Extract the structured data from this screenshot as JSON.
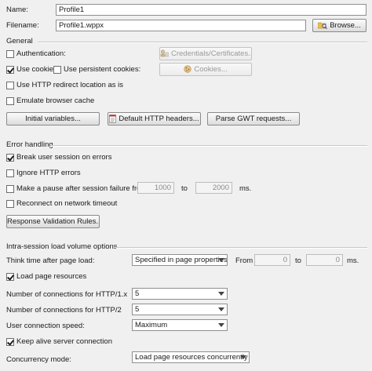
{
  "name_label": "Name:",
  "name_value": "Profile1",
  "filename_label": "Filename:",
  "filename_value": "Profile1.wppx",
  "browse_label": "Browse...",
  "general": {
    "title": "General",
    "authentication": {
      "label": "Authentication:",
      "checked": false
    },
    "credentials_button": "Credentials/Certificates...",
    "use_cookies": {
      "label": "Use cookies",
      "checked": true
    },
    "use_persistent_cookies": {
      "label": "Use persistent cookies:",
      "checked": false
    },
    "cookies_button": "Cookies...",
    "http_redirect": {
      "label": "Use HTTP redirect location as is",
      "checked": false
    },
    "emulate_cache": {
      "label": "Emulate browser cache",
      "checked": false
    },
    "initial_variables_button": "Initial variables...",
    "default_headers_button": "Default HTTP headers...",
    "parse_gwt_button": "Parse GWT requests..."
  },
  "error_handling": {
    "title": "Error handling",
    "break_session": {
      "label": "Break user session on errors",
      "checked": true
    },
    "ignore_http": {
      "label": "Ignore HTTP errors",
      "checked": false
    },
    "make_pause": {
      "label": "Make a pause after session failure from",
      "checked": false
    },
    "pause_from": "1000",
    "to_label": "to",
    "pause_to": "2000",
    "ms_label": "ms.",
    "reconnect": {
      "label": "Reconnect on network timeout",
      "checked": false
    },
    "response_validation_button": "Response Validation Rules..."
  },
  "intra_session": {
    "title": "Intra-session load volume options",
    "think_time_label": "Think time after page load:",
    "think_time_value": "Specified in page properties",
    "from_label": "From",
    "from_value": "0",
    "to_label": "to",
    "to_value": "0",
    "ms_label": "ms.",
    "load_resources": {
      "label": "Load page resources",
      "checked": true
    },
    "http1_label": "Number of connections for HTTP/1.x",
    "http1_value": "5",
    "http2_label": "Number of connections for HTTP/2",
    "http2_value": "5",
    "speed_label": "User connection speed:",
    "speed_value": "Maximum",
    "keep_alive": {
      "label": "Keep alive server connection",
      "checked": true
    },
    "concurrency_label": "Concurrency mode:",
    "concurrency_value": "Load page resources concurrently"
  }
}
